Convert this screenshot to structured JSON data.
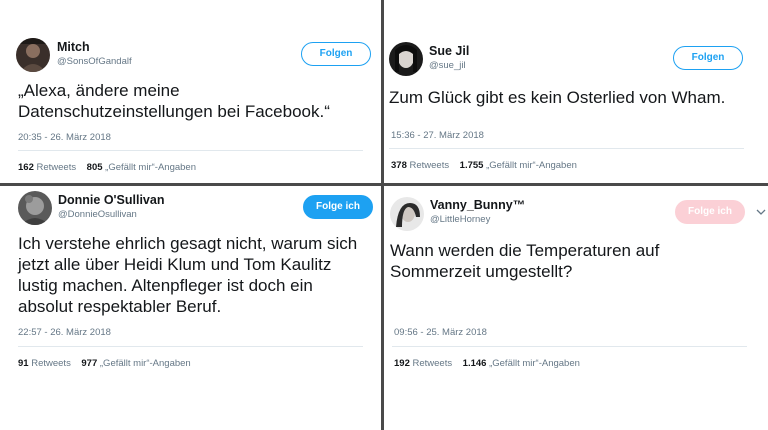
{
  "tweets": [
    {
      "name": "Mitch",
      "handle": "@SonsOfGandalf",
      "follow_label": "Folgen",
      "text_lines": [
        "„Alexa, ändere meine",
        "Datenschutzeinstellungen bei Facebook.“"
      ],
      "date": "20:35 - 26. März 2018",
      "retweets": "162",
      "retweets_label": "Retweets",
      "likes": "805",
      "likes_label": "„Gefällt mir“-Angaben"
    },
    {
      "name": "Sue Jil",
      "handle": "@sue_jil",
      "follow_label": "Folgen",
      "text_lines": [
        "Zum Glück gibt es kein Osterlied von Wham."
      ],
      "date": "15:36 - 27. März 2018",
      "retweets": "378",
      "retweets_label": "Retweets",
      "likes": "1.755",
      "likes_label": "„Gefällt mir“-Angaben"
    },
    {
      "name": "Donnie O'Sullivan",
      "handle": "@DonnieOsullivan",
      "follow_label": "Folge ich",
      "text_lines": [
        "Ich verstehe ehrlich gesagt nicht, warum sich",
        "jetzt alle über Heidi Klum und Tom Kaulitz",
        "lustig machen. Altenpfleger ist doch ein",
        "absolut respektabler Beruf."
      ],
      "date": "22:57 - 26. März 2018",
      "retweets": "91",
      "retweets_label": "Retweets",
      "likes": "977",
      "likes_label": "„Gefällt mir“-Angaben"
    },
    {
      "name": "Vanny_Bunny™",
      "handle": "@LittleHorney",
      "follow_label": "Folge ich",
      "text_lines": [
        "Wann werden die Temperaturen auf",
        "Sommerzeit umgestellt?"
      ],
      "date": "09:56 - 25. März 2018",
      "retweets": "192",
      "retweets_label": "Retweets",
      "likes": "1.146",
      "likes_label": "„Gefällt mir“-Angaben"
    }
  ],
  "colors": {
    "accent": "#1da1f2",
    "pink_button": "#fbd0d6",
    "secondary_text": "#657786",
    "divider": "#4a4a4a"
  },
  "icons": {
    "more_menu": "chevron-down-icon"
  }
}
